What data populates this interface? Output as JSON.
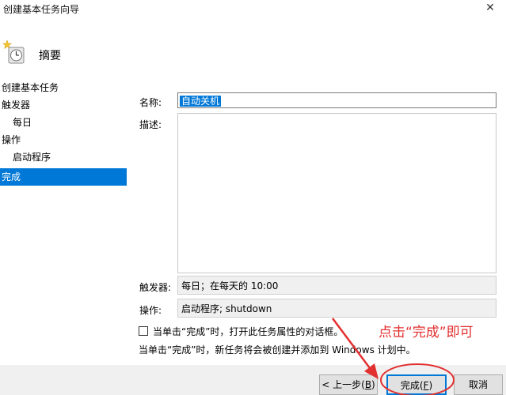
{
  "window": {
    "title": "创建基本任务向导",
    "close_glyph": "✕"
  },
  "header": {
    "title": "摘要",
    "icon": "clock-wizard-icon"
  },
  "sidebar": {
    "items": [
      {
        "label": "创建基本任务"
      },
      {
        "label": "触发器"
      },
      {
        "label": "每日"
      },
      {
        "label": "操作"
      },
      {
        "label": "启动程序"
      },
      {
        "label": "完成"
      }
    ]
  },
  "form": {
    "name_label": "名称:",
    "name_value": "自动关机",
    "description_label": "描述:",
    "description_value": "",
    "trigger_label": "触发器:",
    "trigger_value": "每日；在每天的 10:00",
    "action_label": "操作:",
    "action_value": "启动程序; shutdown",
    "open_props_checkbox_label": "当单击“完成”时，打开此任务属性的对话框。",
    "open_props_checked": false,
    "note": "当单击“完成”时，新任务将会被创建并添加到 Windows 计划中。"
  },
  "annotation": {
    "text": "点击“完成”即可",
    "color": "#e23030"
  },
  "buttons": {
    "back_prefix": "< 上一步(",
    "back_key": "B",
    "back_suffix": ")",
    "finish_prefix": "完成(",
    "finish_key": "F",
    "finish_suffix": ")",
    "cancel": "取消"
  },
  "colors": {
    "accent": "#0078d7",
    "annotation": "#e23030",
    "footer_bg": "#f0f0f0"
  }
}
